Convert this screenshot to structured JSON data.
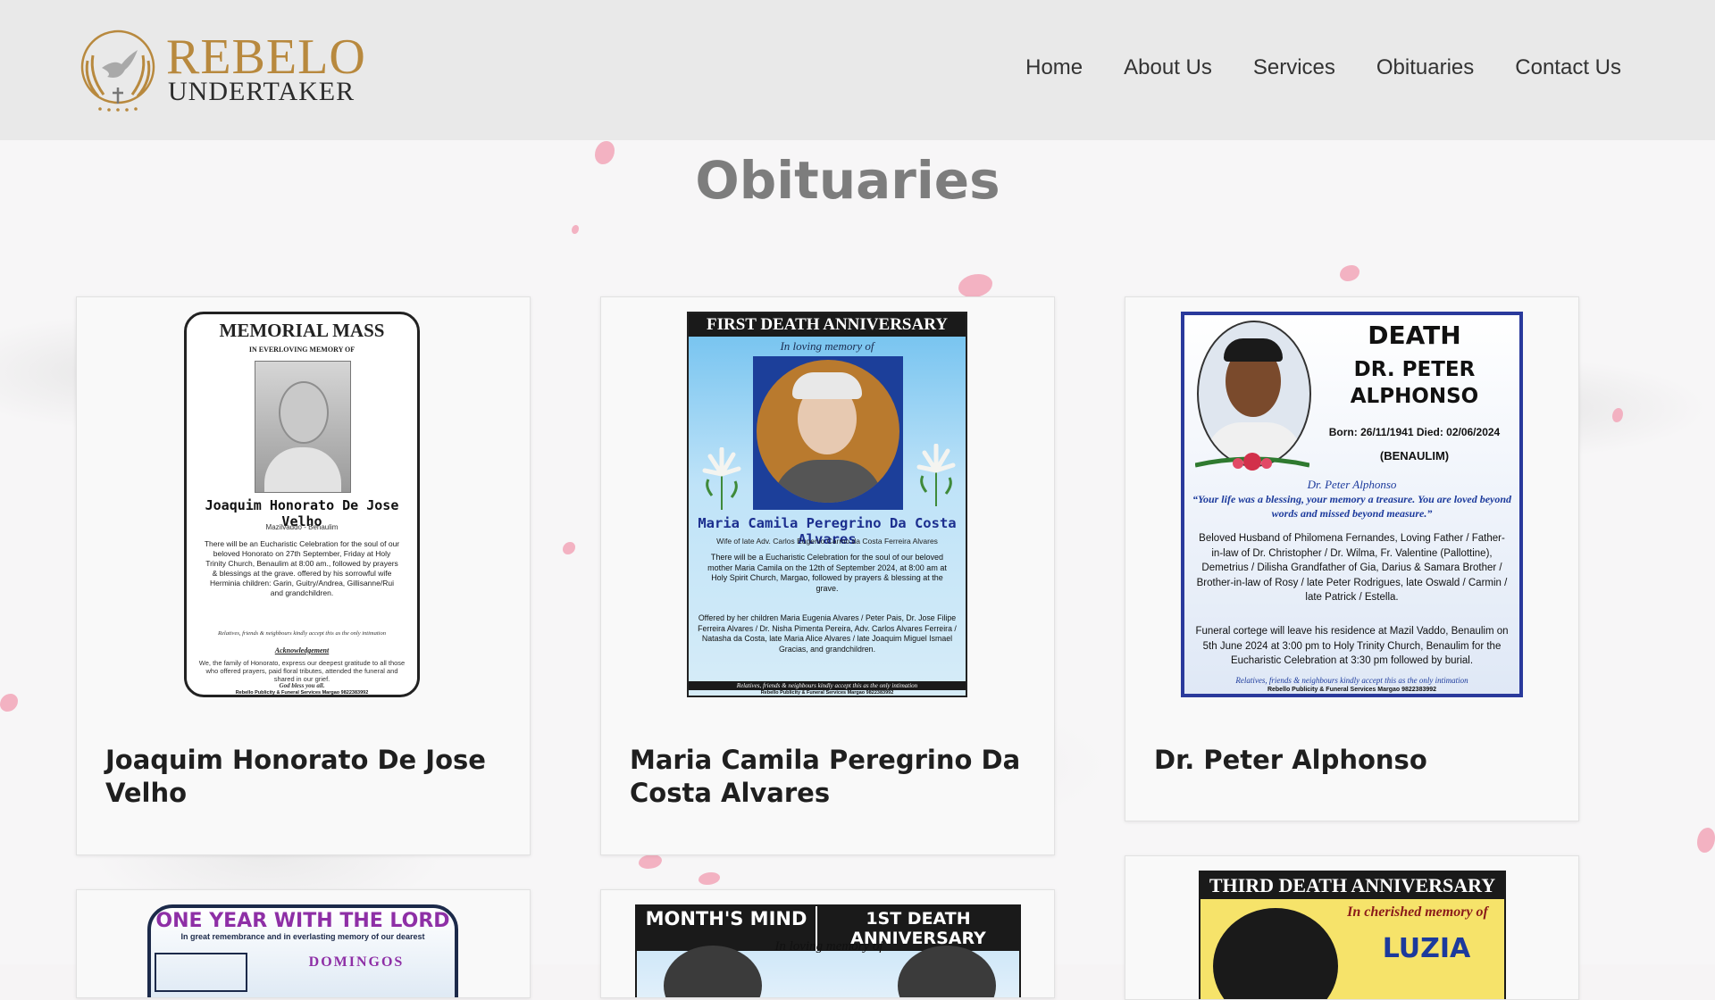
{
  "brand": {
    "word1": "REBELO",
    "word2": "UNDERTAKER"
  },
  "nav": [
    "Home",
    "About Us",
    "Services",
    "Obituaries",
    "Contact Us"
  ],
  "page_title": "Obituaries",
  "cards": [
    {
      "name": "Joaquim Honorato De Jose Velho",
      "poster": {
        "heading": "MEMORIAL MASS",
        "sub": "IN EVERLOVING MEMORY OF",
        "name": "Joaquim Honorato De Jose Velho",
        "place": "Mazilvaddo - Benaulim",
        "body": "There will be an Eucharistic Celebration for the soul of our beloved Honorato on 27th September, Friday at Holy Trinity Church, Benaulim at 8:00 am., followed by prayers & blessings at the grave. offered by his sorrowful wife Herminia children: Garin, Guitry/Andrea, Gillisanne/Rui and grandchildren.",
        "note": "Relatives, friends & neighbours kindly accept this as the only intimation",
        "ack_title": "Acknowledgement",
        "ack": "We, the family of Honorato, express our deepest gratitude to all those who offered prayers, paid floral tributes, attended the funeral and shared in our grief.",
        "ack_bless": "God bless you all.",
        "credit": "Rebello Publicity & Funeral Services Margao 9822383992"
      }
    },
    {
      "name": "Maria Camila Peregrino Da Costa Alvares",
      "poster": {
        "heading": "FIRST DEATH ANNIVERSARY",
        "sub": "In loving memory of",
        "name": "Maria Camila Peregrino Da Costa Alvares",
        "wife_of": "Wife of late Adv. Carlos Eugenio Carmo da Costa Ferreira Alvares",
        "body": "There will be a Eucharistic Celebration for the soul of our beloved mother Maria Camila on the 12th of September 2024, at 8:00 am at Holy Spirit Church, Margao, followed by prayers & blessing at the grave.",
        "offered": "Offered by her children Maria Eugenia Alvares / Peter Pais, Dr. Jose Filipe Ferreira Alvares / Dr. Nisha Pimenta Pereira, Adv. Carlos Alvares Ferreira / Natasha da Costa, late Maria Alice Alvares / late Joaquim Miguel Ismael Gracias, and grandchildren.",
        "note": "Relatives, friends & neighbours kindly accept this as the only intimation",
        "credit": "Rebello Publicity & Funeral Services Margao 9822383992"
      }
    },
    {
      "name": "Dr. Peter Alphonso",
      "poster": {
        "heading": "DEATH",
        "name_line1": "DR. PETER",
        "name_line2": "ALPHONSO",
        "dates": "Born: 26/11/1941  Died: 02/06/2024",
        "place": "(BENAULIM)",
        "sig": "Dr. Peter Alphonso",
        "quote": "“Your life was a blessing, your memory a treasure. You are loved beyond words and missed beyond measure.”",
        "family": "Beloved Husband of Philomena Fernandes, Loving Father / Father-in-law of Dr. Christopher / Dr. Wilma, Fr. Valentine (Pallottine), Demetrius / Dilisha Grandfather of Gia, Darius & Samara Brother / Brother-in-law of Rosy / late Peter Rodrigues, late Oswald / Carmin / late Patrick / Estella.",
        "funeral": "Funeral cortege will leave his residence at Mazil Vaddo, Benaulim on 5th June 2024 at 3:00 pm to Holy Trinity Church, Benaulim for the Eucharistic Celebration at 3:30 pm followed by burial.",
        "note": "Relatives, friends & neighbours kindly accept this as the only intimation",
        "credit": "Rebello Publicity & Funeral Services Margao 9822383992"
      }
    },
    {
      "poster": {
        "heading": "ONE YEAR WITH THE LORD",
        "sub": "In great remembrance and in everlasting memory of our dearest",
        "name": "DOMINGOS"
      }
    },
    {
      "poster": {
        "heading_left": "MONTH'S MIND",
        "heading_right": "1ST DEATH ANNIVERSARY",
        "sub": "In loving memory of"
      }
    },
    {
      "poster": {
        "heading": "THIRD DEATH ANNIVERSARY",
        "sub": "In cherished memory of",
        "name": "LUZIA"
      }
    }
  ]
}
